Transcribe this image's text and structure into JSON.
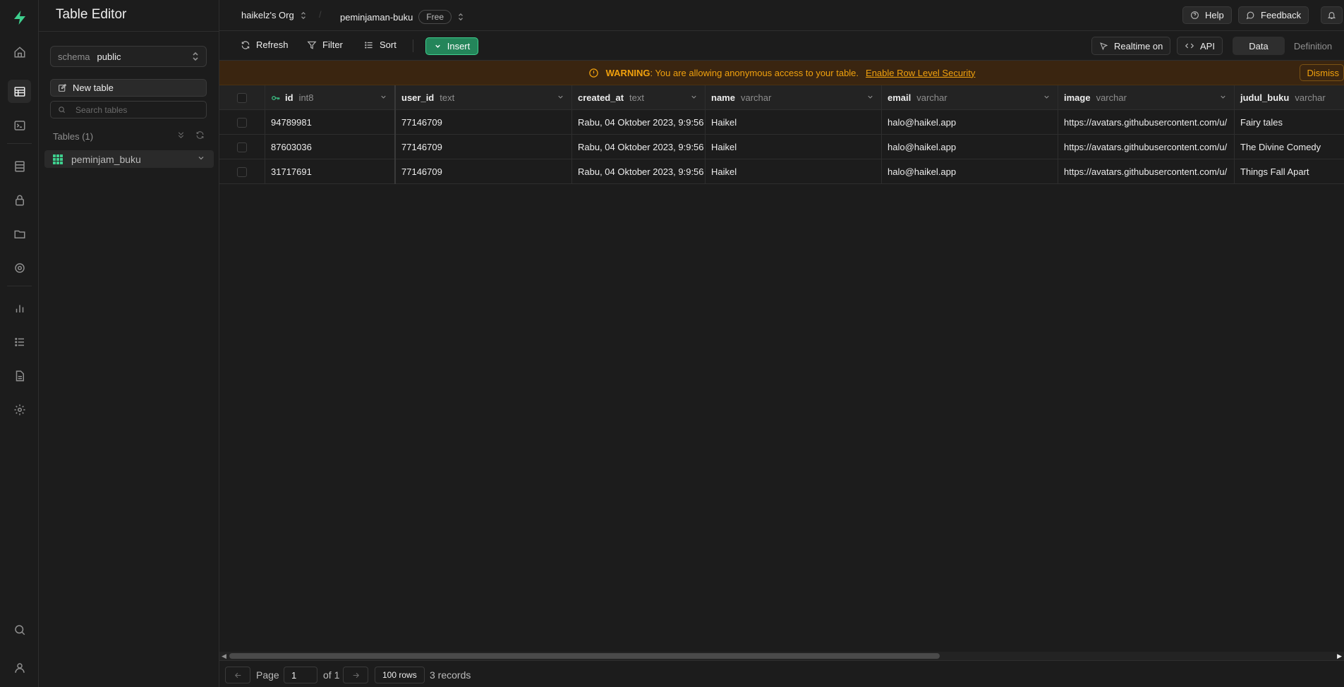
{
  "app": {
    "title": "Table Editor"
  },
  "sidebar": {
    "schema_label": "schema",
    "schema_value": "public",
    "new_table_label": "New table",
    "search_placeholder": "Search tables",
    "tables_heading": "Tables (1)",
    "tables": [
      {
        "name": "peminjam_buku"
      }
    ]
  },
  "topbar": {
    "org": "haikelz's Org",
    "project": "peminjaman-buku",
    "plan_badge": "Free",
    "help_label": "Help",
    "feedback_label": "Feedback"
  },
  "toolbar": {
    "refresh_label": "Refresh",
    "filter_label": "Filter",
    "sort_label": "Sort",
    "insert_label": "Insert",
    "realtime_label": "Realtime on",
    "api_label": "API",
    "view_tabs": [
      "Data",
      "Definition"
    ],
    "active_view": "Data"
  },
  "warning": {
    "prefix": "WARNING",
    "message": ": You are allowing anonymous access to your table.",
    "link_label": "Enable Row Level Security",
    "dismiss_label": "Dismiss"
  },
  "grid": {
    "columns": [
      {
        "name": "id",
        "type": "int8",
        "primary_key": true
      },
      {
        "name": "user_id",
        "type": "text"
      },
      {
        "name": "created_at",
        "type": "text"
      },
      {
        "name": "name",
        "type": "varchar"
      },
      {
        "name": "email",
        "type": "varchar"
      },
      {
        "name": "image",
        "type": "varchar"
      },
      {
        "name": "judul_buku",
        "type": "varchar"
      }
    ],
    "rows": [
      [
        "94789981",
        "77146709",
        "Rabu, 04 Oktober 2023, 9:9:56",
        "Haikel",
        "halo@haikel.app",
        "https://avatars.githubusercontent.com/u/",
        "Fairy tales"
      ],
      [
        "87603036",
        "77146709",
        "Rabu, 04 Oktober 2023, 9:9:56",
        "Haikel",
        "halo@haikel.app",
        "https://avatars.githubusercontent.com/u/",
        "The Divine Comedy"
      ],
      [
        "31717691",
        "77146709",
        "Rabu, 04 Oktober 2023, 9:9:56",
        "Haikel",
        "halo@haikel.app",
        "https://avatars.githubusercontent.com/u/",
        "Things Fall Apart"
      ]
    ]
  },
  "footer": {
    "page_label": "Page",
    "page_value": "1",
    "of_label": "of 1",
    "rows_label": "100 rows",
    "records_label": "3 records"
  },
  "colors": {
    "brand": "#3ecf8e",
    "background": "#1c1c1c",
    "warning": "#f1a10d"
  }
}
